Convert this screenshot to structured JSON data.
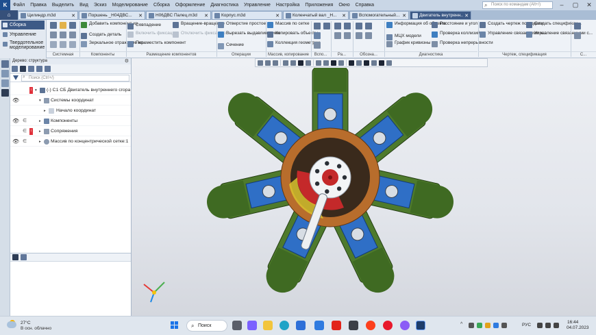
{
  "menu": {
    "items": [
      "Файл",
      "Правка",
      "Выделить",
      "Вид",
      "Эскиз",
      "Моделирование",
      "Сборка",
      "Оформление",
      "Диагностика",
      "Управление",
      "Настройка",
      "Приложения",
      "Окно",
      "Справка"
    ],
    "search_placeholder": "Поиск по командам (Alt+/)"
  },
  "tabs": [
    {
      "label": "Цилиндр.m3d",
      "active": false
    },
    {
      "label": "Поршень _Н04ДВС...",
      "active": false
    },
    {
      "label": "Н06ДВС Палец.m3d",
      "active": false
    },
    {
      "label": "Корпус.m3d",
      "active": false
    },
    {
      "label": "Коленчатый вал _Н...",
      "active": false
    },
    {
      "label": "Вспомогательный...",
      "active": false
    },
    {
      "label": "Двигатель внутренн...",
      "active": true
    }
  ],
  "ribbon": {
    "modes": [
      {
        "label": "Сборка",
        "active": true
      },
      {
        "label": "Управление",
        "active": false
      },
      {
        "label": "Твердотельное моделирование",
        "active": false
      }
    ],
    "groups": [
      {
        "label": "Системная"
      },
      {
        "label": "Компоненты"
      },
      {
        "label": "Размещение компонентов"
      },
      {
        "label": "Операции"
      },
      {
        "label": "Массив, копирование"
      },
      {
        "label": "Вспо..."
      },
      {
        "label": "Ра..."
      },
      {
        "label": "Обозна..."
      },
      {
        "label": "Диагностика"
      },
      {
        "label": "Чертеж, спецификация"
      },
      {
        "label": "С..."
      }
    ],
    "buttons": {
      "add_component": "Добавить компонент из...",
      "create_part": "Создать деталь",
      "mirror": "Зеркальное отражение ко...",
      "coincidence": "Совпадение",
      "include_fix": "Включить фиксацию",
      "move_component": "Переместить компонент",
      "rotation": "Вращение-вращение",
      "disable_fix": "Отключить фиксацию",
      "extrude_hole": "Отверстие простое",
      "cut_extrude": "Вырезать выдавливанием",
      "section": "Сечение",
      "array_grid": "Массив по сетке",
      "copy_objects": "Копировать объекты",
      "geometry_collection": "Коллекция геометрии",
      "object_info": "Информация об объекте",
      "mcx": "МЦХ модели",
      "curvature": "График кривизны",
      "distance_angle": "Расстояние и угол",
      "collision_check": "Проверка коллизий",
      "continuity_check": "Проверка непрерывности",
      "create_drawing": "Создать чертеж по модели",
      "linked_drawings": "Управление связанными ч...",
      "create_spec": "Создать спецификац...",
      "linked_specs": "Управление связанными с..."
    }
  },
  "tree": {
    "header": "Дерево: структура",
    "search_placeholder": "Поиск (Ctrl+/)",
    "rows": [
      {
        "label": "(-) С1 СБ Двигатель внутреннего сгора"
      },
      {
        "label": "Системы координат"
      },
      {
        "label": "Начало координат"
      },
      {
        "label": "Компоненты"
      },
      {
        "label": "Сопряжения"
      },
      {
        "label": "Массив по концентрической сетке:1"
      }
    ],
    "error_mark": "!"
  },
  "taskbar": {
    "weather_temp": "27°C",
    "weather_desc": "В осн. облачно",
    "search_label": "Поиск",
    "language": "РУС",
    "time": "16:44",
    "date": "04.07.2023"
  },
  "colors": {
    "accent": "#3d5a86",
    "model_green": "#4e7a2c",
    "model_blue": "#2f6fc6",
    "model_orange": "#b86d2c",
    "model_red": "#c4292a",
    "error_red": "#e0303a"
  },
  "icons": {
    "axis_triad": "axis-triad-icon",
    "eye": "eye-icon",
    "filter": "filter-icon"
  }
}
